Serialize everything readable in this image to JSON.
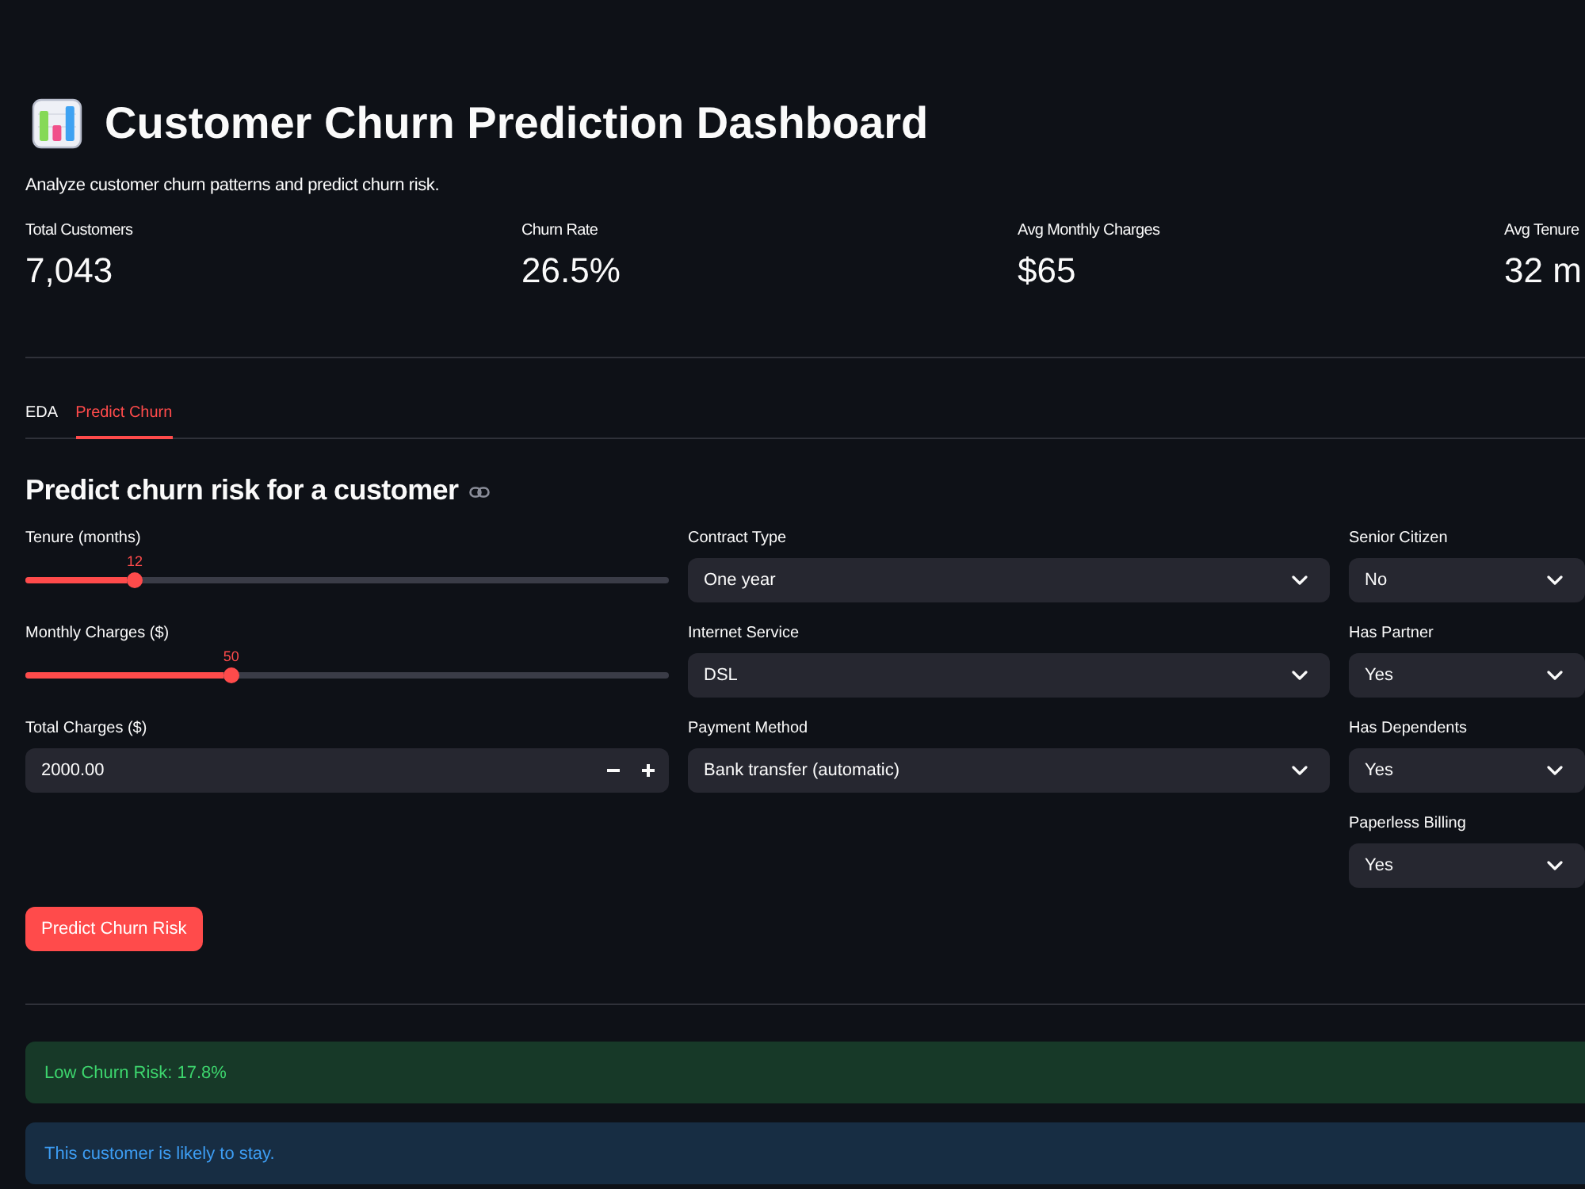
{
  "header": {
    "title": "Customer Churn Prediction Dashboard",
    "subtitle": "Analyze customer churn patterns and predict churn risk."
  },
  "metrics": [
    {
      "label": "Total Customers",
      "value": "7,043"
    },
    {
      "label": "Churn Rate",
      "value": "26.5%"
    },
    {
      "label": "Avg Monthly Charges",
      "value": "$65"
    },
    {
      "label": "Avg Tenure",
      "value": "32 m"
    }
  ],
  "tabs": [
    {
      "label": "EDA",
      "selected": false
    },
    {
      "label": "Predict Churn",
      "selected": true
    }
  ],
  "form": {
    "heading": "Predict churn risk for a customer",
    "columns": [
      [
        {
          "kind": "slider",
          "label": "Tenure (months)",
          "value": "12",
          "level": 0.17
        },
        {
          "kind": "slider",
          "label": "Monthly Charges ($)",
          "value": "50",
          "level": 0.32
        },
        {
          "kind": "number",
          "label": "Total Charges ($)",
          "value": "2000.00"
        }
      ],
      [
        {
          "kind": "select",
          "label": "Contract Type",
          "value": "One year"
        },
        {
          "kind": "select",
          "label": "Internet Service",
          "value": "DSL"
        },
        {
          "kind": "select",
          "label": "Payment Method",
          "value": "Bank transfer (automatic)"
        }
      ],
      [
        {
          "kind": "select",
          "label": "Senior Citizen",
          "value": "No"
        },
        {
          "kind": "select",
          "label": "Has Partner",
          "value": "Yes"
        },
        {
          "kind": "select",
          "label": "Has Dependents",
          "value": "Yes"
        },
        {
          "kind": "select",
          "label": "Paperless Billing",
          "value": "Yes"
        }
      ]
    ]
  },
  "submit_button": {
    "label": "Predict Churn Risk"
  },
  "results": [
    {
      "kind": "success",
      "text": "Low Churn Risk: 17.8%"
    },
    {
      "kind": "info",
      "text": "This customer is likely to stay."
    }
  ]
}
